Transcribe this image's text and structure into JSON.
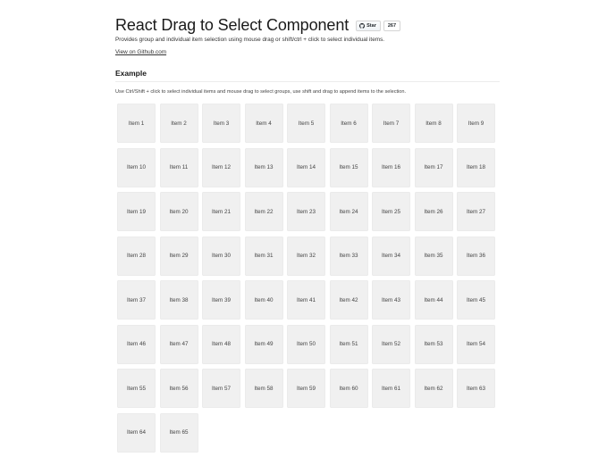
{
  "header": {
    "title": "React Drag to Select Component",
    "star_label": "Star",
    "star_count": "267",
    "github_icon": "github-mark-icon"
  },
  "intro": {
    "description": "Provides group and individual item selection using mouse drag or shift/ctrl + click to select individual items.",
    "github_link": "View on Github.com"
  },
  "example": {
    "heading": "Example",
    "instructions": "Use Ctrl/Shift + click to select individual items and mouse drag to select groups, use shift and drag to append items to the selection."
  },
  "grid": {
    "items": [
      "Item 1",
      "Item 2",
      "Item 3",
      "Item 4",
      "Item 5",
      "Item 6",
      "Item 7",
      "Item 8",
      "Item 9",
      "Item 10",
      "Item 11",
      "Item 12",
      "Item 13",
      "Item 14",
      "Item 15",
      "Item 16",
      "Item 17",
      "Item 18",
      "Item 19",
      "Item 20",
      "Item 21",
      "Item 22",
      "Item 23",
      "Item 24",
      "Item 25",
      "Item 26",
      "Item 27",
      "Item 28",
      "Item 29",
      "Item 30",
      "Item 31",
      "Item 32",
      "Item 33",
      "Item 34",
      "Item 35",
      "Item 36",
      "Item 37",
      "Item 38",
      "Item 39",
      "Item 40",
      "Item 41",
      "Item 42",
      "Item 43",
      "Item 44",
      "Item 45",
      "Item 46",
      "Item 47",
      "Item 48",
      "Item 49",
      "Item 50",
      "Item 51",
      "Item 52",
      "Item 53",
      "Item 54",
      "Item 55",
      "Item 56",
      "Item 57",
      "Item 58",
      "Item 59",
      "Item 60",
      "Item 61",
      "Item 62",
      "Item 63",
      "Item 64",
      "Item 65"
    ]
  },
  "colors": {
    "item_background": "#f0f0f0",
    "text": "#1a1a1a"
  }
}
